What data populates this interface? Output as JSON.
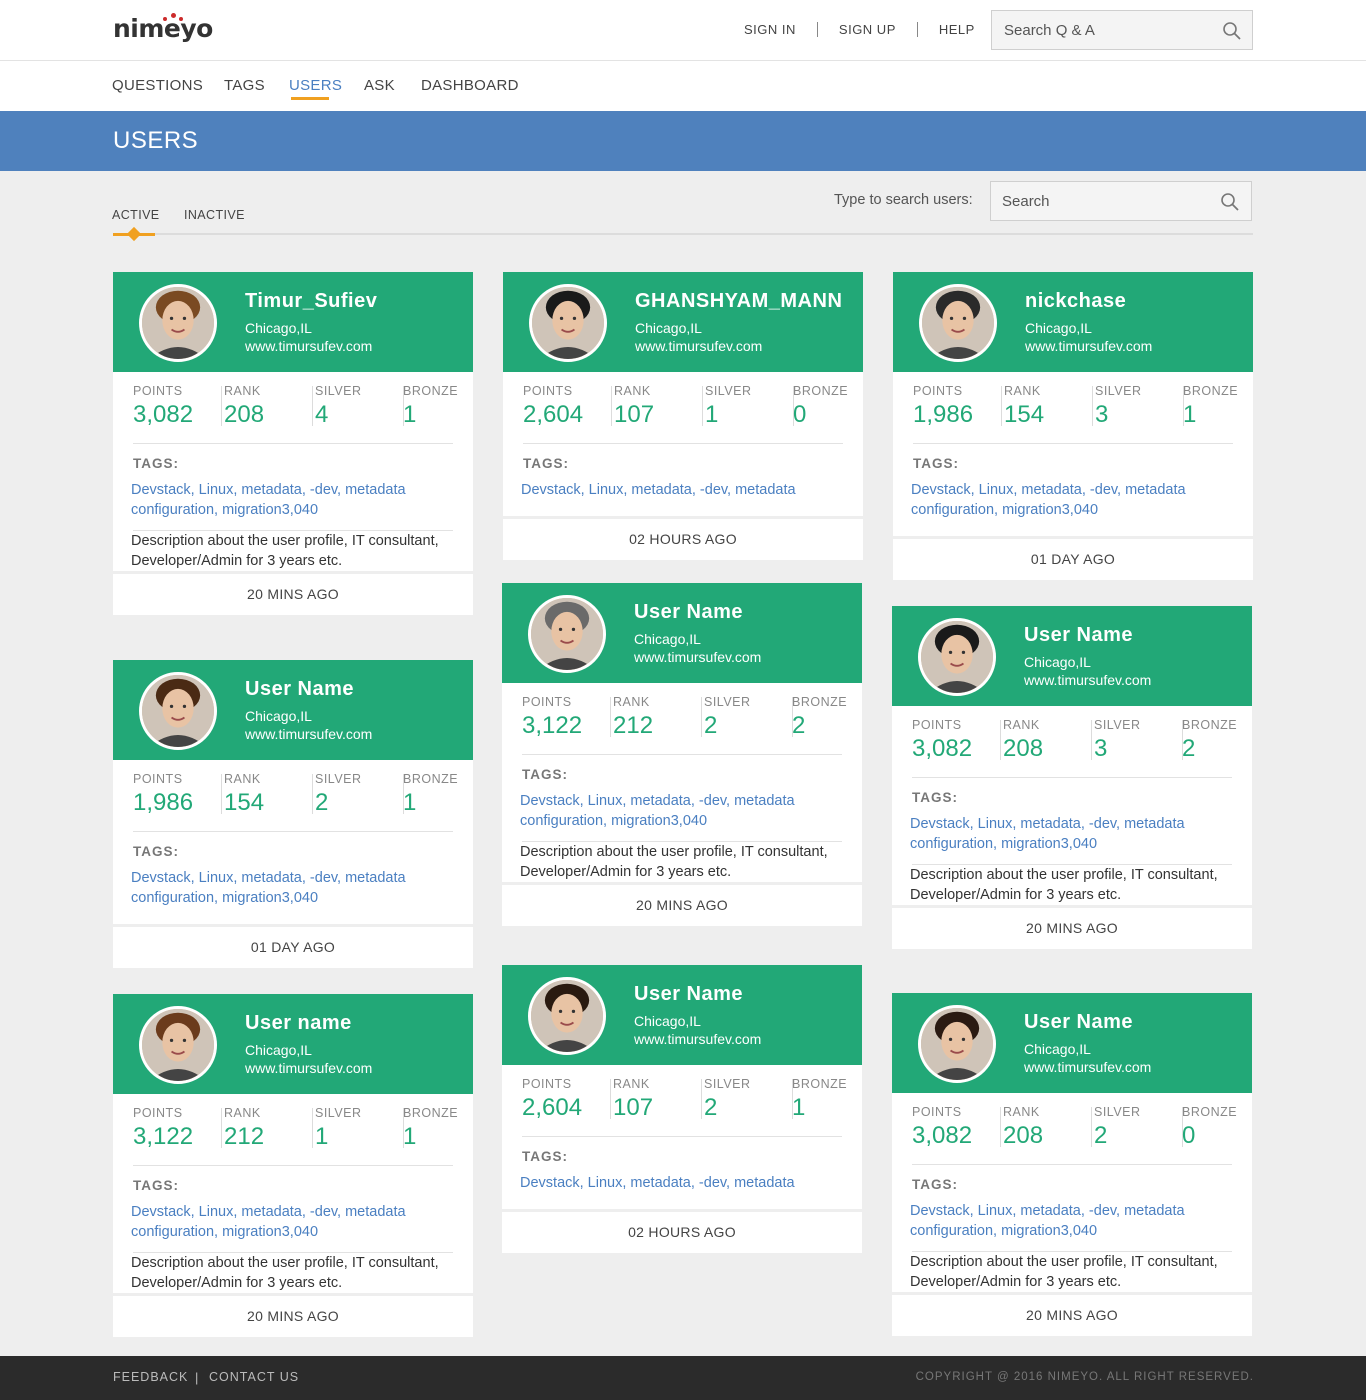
{
  "brand": {
    "logo_text": "nimeyo"
  },
  "top_links": [
    "SIGN IN",
    "SIGN UP",
    "HELP"
  ],
  "top_search": {
    "placeholder": "Search Q & A"
  },
  "nav": {
    "items": [
      "QUESTIONS",
      "TAGS",
      "USERS",
      "ASK",
      "DASHBOARD"
    ],
    "active": "USERS"
  },
  "banner": {
    "title": "USERS"
  },
  "subtabs": {
    "active": "ACTIVE",
    "inactive": "INACTIVE"
  },
  "user_search": {
    "label": "Type to search users:",
    "placeholder": "Search"
  },
  "stat_labels": {
    "points": "POINTS",
    "rank": "RANK",
    "silver": "SILVER",
    "bronze": "BRONZE"
  },
  "tags_label": "TAGS:",
  "cards": [
    {
      "name": "Timur_Sufiev",
      "location": "Chicago,IL",
      "website": "www.timursufev.com",
      "points": "3,082",
      "rank": "208",
      "silver": "4",
      "bronze": "1",
      "tags": "Devstack, Linux, metadata, -dev, metadata configuration, migration3,040",
      "description": "Description about the user profile, IT consultant, Developer/Admin for 3 years etc.",
      "time": "20 MINS AGO"
    },
    {
      "name": "User Name",
      "location": "Chicago,IL",
      "website": "www.timursufev.com",
      "points": "1,986",
      "rank": "154",
      "silver": "2",
      "bronze": "1",
      "tags": "Devstack, Linux, metadata, -dev, metadata configuration, migration3,040",
      "description": "",
      "time": "01 DAY AGO"
    },
    {
      "name": "User name",
      "location": "Chicago,IL",
      "website": "www.timursufev.com",
      "points": "3,122",
      "rank": "212",
      "silver": "1",
      "bronze": "1",
      "tags": "Devstack, Linux, metadata, -dev, metadata configuration, migration3,040",
      "description": "Description about the user profile, IT consultant, Developer/Admin for 3 years etc.",
      "time": "20 MINS AGO"
    },
    {
      "name": "GHANSHYAM_MANN",
      "location": "Chicago,IL",
      "website": "www.timursufev.com",
      "points": "2,604",
      "rank": "107",
      "silver": "1",
      "bronze": "0",
      "tags": "Devstack, Linux, metadata, -dev, metadata",
      "description": "",
      "time": "02 HOURS AGO"
    },
    {
      "name": "User Name",
      "location": "Chicago,IL",
      "website": "www.timursufev.com",
      "points": "3,122",
      "rank": "212",
      "silver": "2",
      "bronze": "2",
      "tags": "Devstack, Linux, metadata, -dev, metadata configuration, migration3,040",
      "description": "Description about the user profile, IT consultant, Developer/Admin for 3 years etc.",
      "time": "20 MINS AGO"
    },
    {
      "name": "User Name",
      "location": "Chicago,IL",
      "website": "www.timursufev.com",
      "points": "2,604",
      "rank": "107",
      "silver": "2",
      "bronze": "1",
      "tags": "Devstack, Linux, metadata, -dev, metadata",
      "description": "",
      "time": "02 HOURS AGO"
    },
    {
      "name": "nickchase",
      "location": "Chicago,IL",
      "website": "www.timursufev.com",
      "points": "1,986",
      "rank": "154",
      "silver": "3",
      "bronze": "1",
      "tags": "Devstack, Linux, metadata, -dev, metadata configuration, migration3,040",
      "description": "",
      "time": "01 DAY AGO"
    },
    {
      "name": "User Name",
      "location": "Chicago,IL",
      "website": "www.timursufev.com",
      "points": "3,082",
      "rank": "208",
      "silver": "3",
      "bronze": "2",
      "tags": "Devstack, Linux, metadata, -dev, metadata configuration, migration3,040",
      "description": "Description about the user profile, IT consultant, Developer/Admin for 3 years etc.",
      "time": "20 MINS AGO"
    },
    {
      "name": "User Name",
      "location": "Chicago,IL",
      "website": "www.timursufev.com",
      "points": "3,082",
      "rank": "208",
      "silver": "2",
      "bronze": "0",
      "tags": "Devstack, Linux, metadata, -dev, metadata configuration, migration3,040",
      "description": "Description about the user profile, IT consultant, Developer/Admin for 3 years etc.",
      "time": "20 MINS AGO"
    }
  ],
  "footer": {
    "feedback": "FEEDBACK",
    "separator": "|",
    "contact": "CONTACT US",
    "copyright": "COPYRIGHT @ 2016 NIMEYO. ALL RIGHT RESERVED."
  },
  "colors": {
    "accent_green": "#22a877",
    "banner_blue": "#4f81bd",
    "link_blue": "#4a7fc1",
    "orange": "#f0a020",
    "footer_bg": "#2b2b2b"
  }
}
